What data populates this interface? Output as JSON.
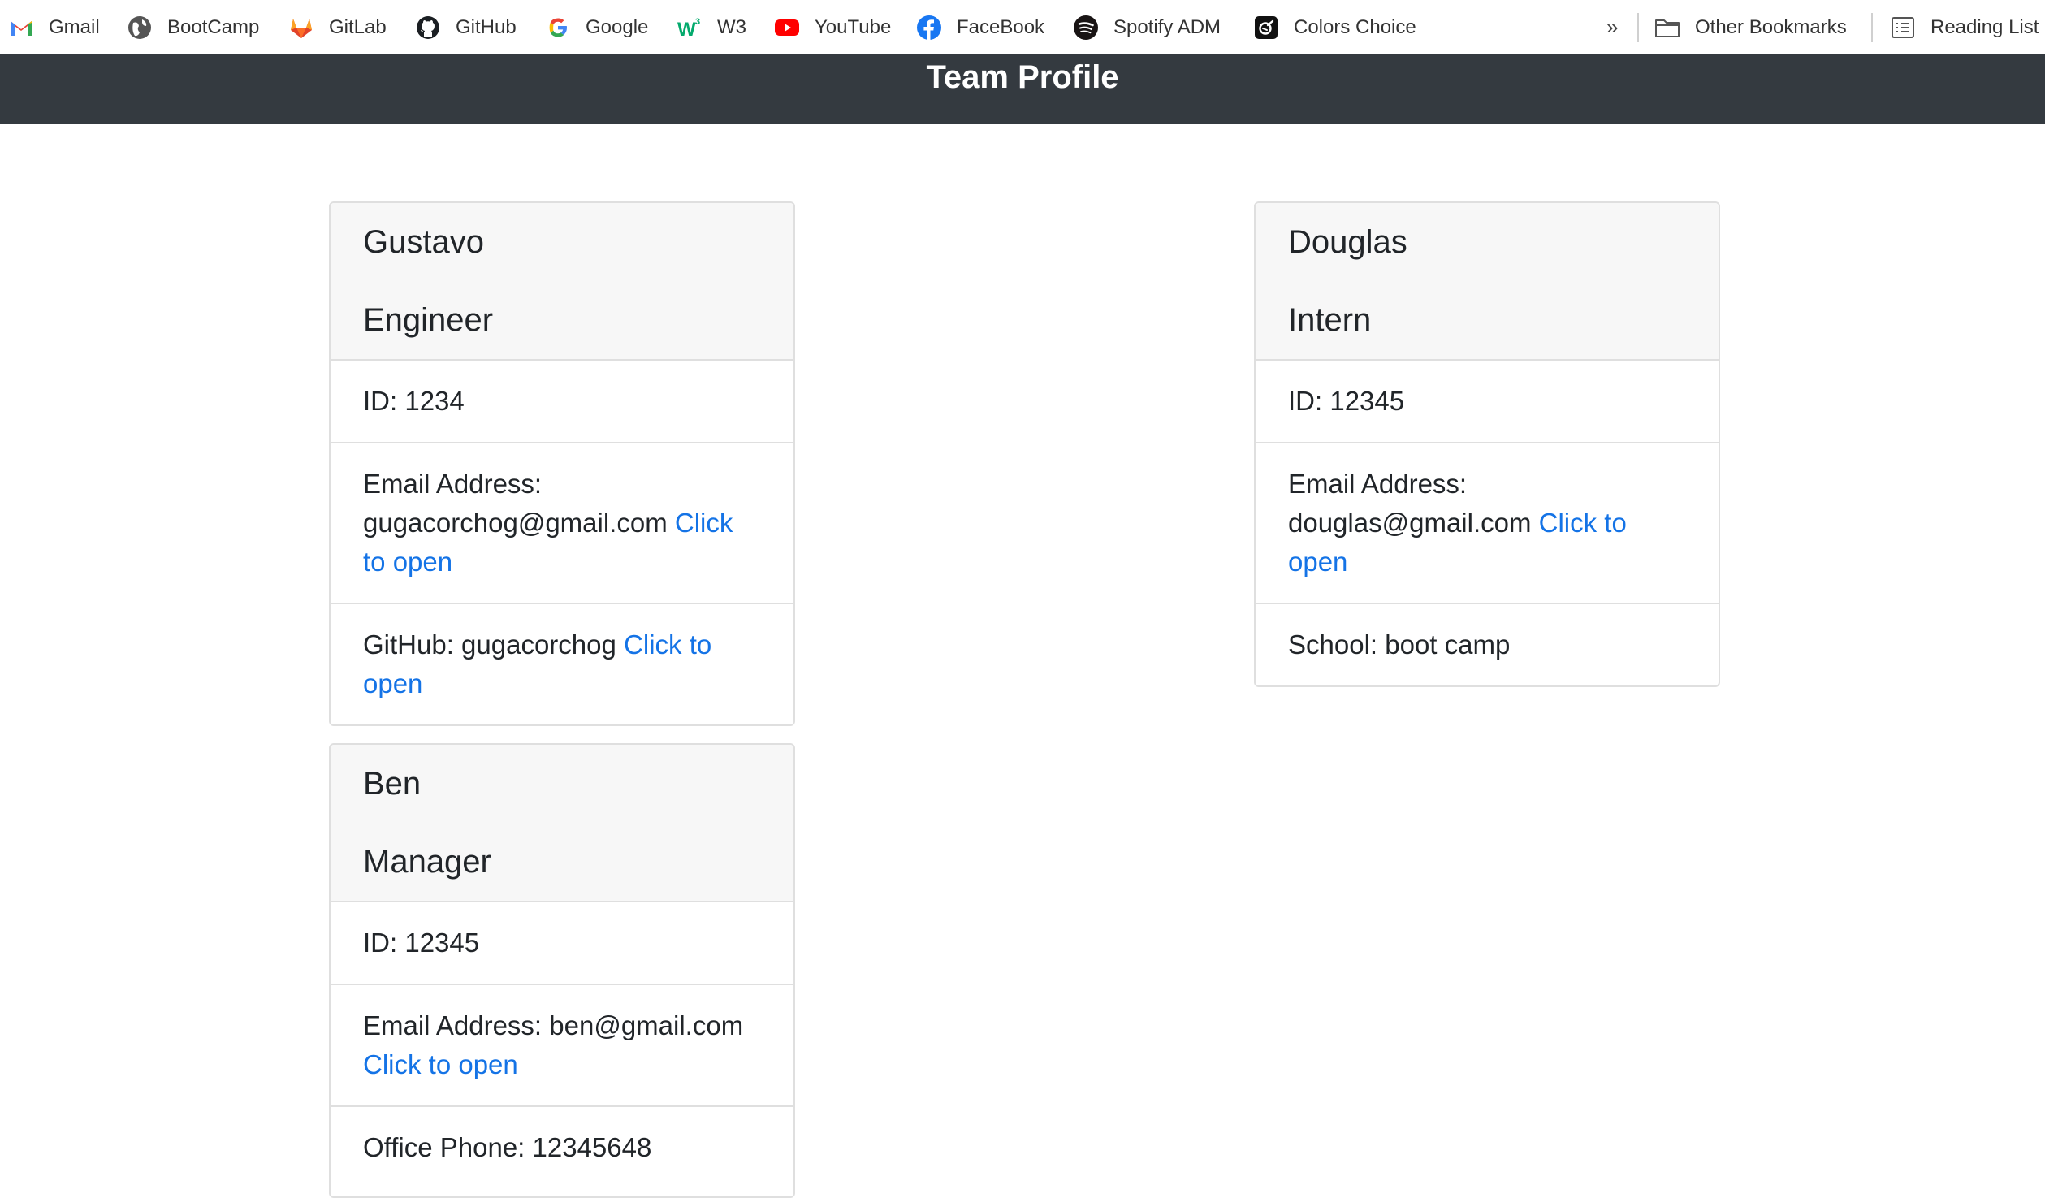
{
  "bookmarks": [
    {
      "label": "Gmail",
      "icon": "gmail-icon"
    },
    {
      "label": "BootCamp",
      "icon": "globe-icon"
    },
    {
      "label": "GitLab",
      "icon": "gitlab-icon"
    },
    {
      "label": "GitHub",
      "icon": "github-icon"
    },
    {
      "label": "Google",
      "icon": "google-icon"
    },
    {
      "label": "W3",
      "icon": "w3-icon"
    },
    {
      "label": "YouTube",
      "icon": "youtube-icon"
    },
    {
      "label": "FaceBook",
      "icon": "facebook-icon"
    },
    {
      "label": "Spotify ADM",
      "icon": "spotify-icon"
    },
    {
      "label": "Colors Choice",
      "icon": "colors-choice-icon"
    }
  ],
  "bookmarks_more": "»",
  "other_bookmarks": {
    "label": "Other Bookmarks",
    "icon": "folder-icon"
  },
  "reading_list": {
    "label": "Reading List",
    "icon": "reading-list-icon"
  },
  "header": {
    "title": "Team Profile"
  },
  "colors": {
    "header_bg": "#343a40",
    "link": "#1473e6",
    "card_header_bg": "#f7f7f7"
  },
  "cards": [
    {
      "name": "Gustavo",
      "role": "Engineer",
      "id": "ID: 1234",
      "email_text": "Email Address: gugacorchog@gmail.com",
      "email_link": "Click to open",
      "extra_text": "GitHub: gugacorchog",
      "extra_link": "Click to open"
    },
    {
      "name": "Douglas",
      "role": "Intern",
      "id": "ID: 12345",
      "email_text": "Email Address: douglas@gmail.com",
      "email_link": "Click to open",
      "extra_text": "School: boot camp"
    },
    {
      "name": "Ben",
      "role": "Manager",
      "id": "ID: 12345",
      "email_text": "Email Address: ben@gmail.com",
      "email_link": "Click to open",
      "extra_text": "Office Phone: 12345648"
    }
  ]
}
